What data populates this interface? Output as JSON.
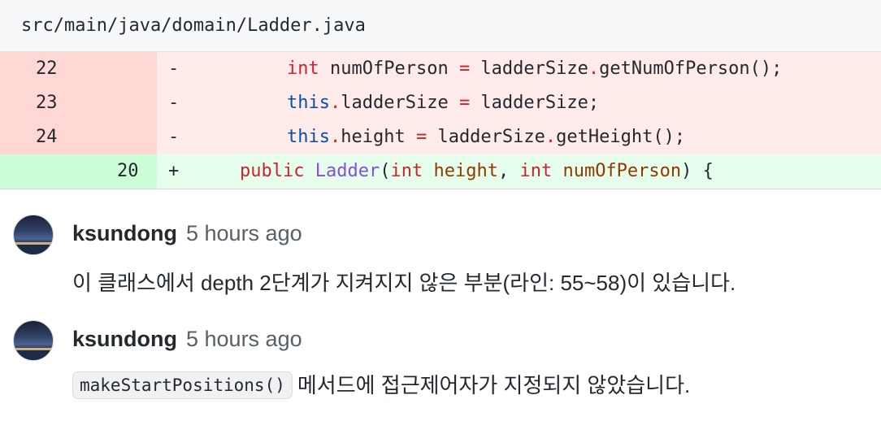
{
  "file": {
    "path": "src/main/java/domain/Ladder.java"
  },
  "diff": {
    "lines": [
      {
        "type": "del",
        "old": "22",
        "new": "",
        "marker": "-"
      },
      {
        "type": "del",
        "old": "23",
        "new": "",
        "marker": "-"
      },
      {
        "type": "del",
        "old": "24",
        "new": "",
        "marker": "-"
      },
      {
        "type": "add",
        "old": "",
        "new": "20",
        "marker": "+"
      }
    ],
    "code": {
      "l22": {
        "kw": "int",
        "a": " numOfPerson ",
        "eq": "=",
        "b": " ladderSize",
        "dot": ".",
        "c": "getNumOfPerson();"
      },
      "l23": {
        "this": "this",
        "dot": ".",
        "a": "ladderSize ",
        "eq": "=",
        "b": " ladderSize;"
      },
      "l24": {
        "this": "this",
        "dot": ".",
        "a": "height ",
        "eq": "=",
        "b": " ladderSize",
        "dot2": ".",
        "c": "getHeight();"
      },
      "l20": {
        "kw1": "public",
        "sp1": " ",
        "fn": "Ladder",
        "p1": "(",
        "kw2": "int",
        "sp2": " ",
        "param1": "height",
        "comma": ", ",
        "kw3": "int",
        "sp3": " ",
        "param2": "numOfPerson",
        "end": ") {"
      }
    }
  },
  "comments": [
    {
      "author": "ksundong",
      "time": "5 hours ago",
      "body": "이 클래스에서 depth 2단계가 지켜지지 않은 부분(라인: 55~58)이 있습니다."
    },
    {
      "author": "ksundong",
      "time": "5 hours ago",
      "code": "makeStartPositions()",
      "body": "메서드에 접근제어자가 지정되지 않았습니다."
    }
  ],
  "icons": {
    "avatar": "user-avatar-photo"
  }
}
